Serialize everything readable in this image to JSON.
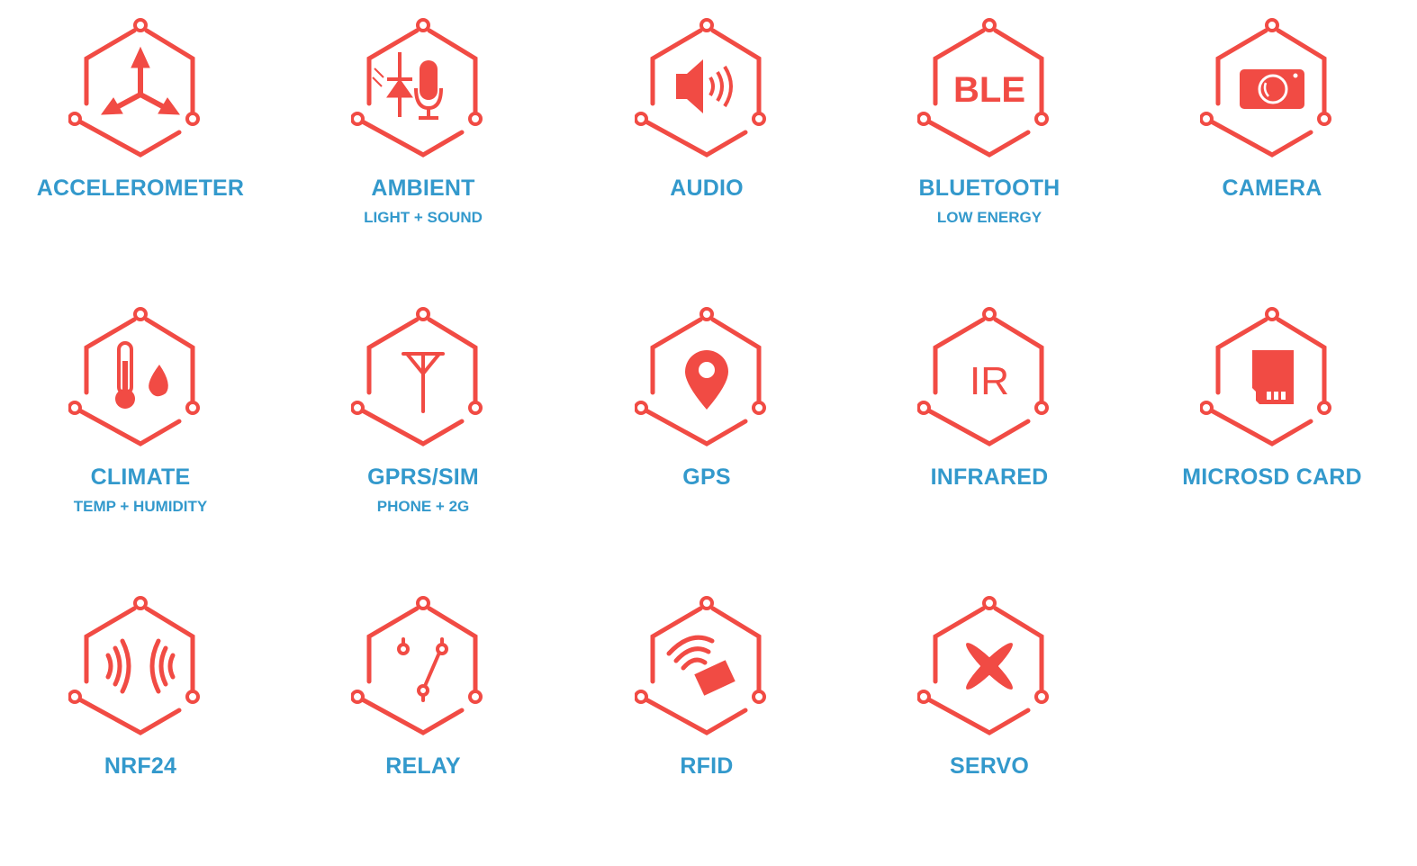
{
  "colors": {
    "icon": "#f14b44",
    "label": "#3399cc",
    "background": "#ffffff"
  },
  "items": [
    {
      "title": "ACCELEROMETER",
      "subtitle": "",
      "icon": "three-arrows-icon"
    },
    {
      "title": "AMBIENT",
      "subtitle": "LIGHT + SOUND",
      "icon": "light-sound-icon"
    },
    {
      "title": "AUDIO",
      "subtitle": "",
      "icon": "speaker-icon"
    },
    {
      "title": "BLUETOOTH",
      "subtitle": "LOW ENERGY",
      "icon": "ble-icon",
      "icon_text": "BLE"
    },
    {
      "title": "CAMERA",
      "subtitle": "",
      "icon": "camera-icon"
    },
    {
      "title": "CLIMATE",
      "subtitle": "TEMP + HUMIDITY",
      "icon": "thermometer-drop-icon"
    },
    {
      "title": "GPRS/SIM",
      "subtitle": "PHONE + 2G",
      "icon": "antenna-icon"
    },
    {
      "title": "GPS",
      "subtitle": "",
      "icon": "map-pin-icon"
    },
    {
      "title": "INFRARED",
      "subtitle": "",
      "icon": "ir-icon",
      "icon_text": "IR"
    },
    {
      "title": "MICROSD CARD",
      "subtitle": "",
      "icon": "sd-card-icon"
    },
    {
      "title": "NRF24",
      "subtitle": "",
      "icon": "radio-waves-icon"
    },
    {
      "title": "RELAY",
      "subtitle": "",
      "icon": "switch-icon"
    },
    {
      "title": "RFID",
      "subtitle": "",
      "icon": "rfid-card-icon"
    },
    {
      "title": "SERVO",
      "subtitle": "",
      "icon": "propeller-icon"
    }
  ]
}
